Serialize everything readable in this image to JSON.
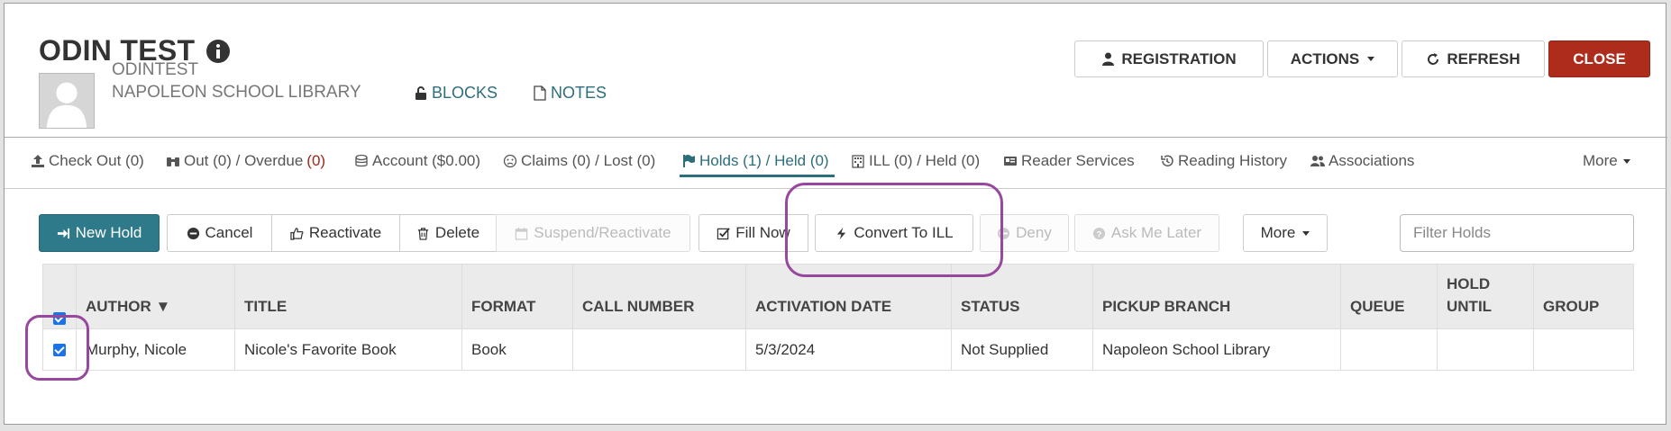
{
  "patron": {
    "name": "ODIN TEST",
    "username": "ODINTEST",
    "library": "NAPOLEON SCHOOL LIBRARY",
    "blocks_label": "BLOCKS",
    "notes_label": "NOTES"
  },
  "top_actions": {
    "registration": "REGISTRATION",
    "actions": "ACTIONS",
    "refresh": "REFRESH",
    "close": "CLOSE"
  },
  "tabs": [
    {
      "icon": "upload-icon",
      "label": "Check Out (0)"
    },
    {
      "icon": "binoculars-icon",
      "label_main": "Out (0) / Overdue ",
      "label_alert": "(0)"
    },
    {
      "icon": "money-icon",
      "label": "Account ($0.00)"
    },
    {
      "icon": "frown-icon",
      "label": "Claims (0) / Lost (0)"
    },
    {
      "icon": "flag-icon",
      "label": "Holds (1) / Held (0)",
      "active": true
    },
    {
      "icon": "building-icon",
      "label": "ILL (0) / Held (0)"
    },
    {
      "icon": "id-card-icon",
      "label": "Reader Services"
    },
    {
      "icon": "history-icon",
      "label": "Reading History"
    },
    {
      "icon": "users-icon",
      "label": "Associations"
    },
    {
      "label": "More"
    }
  ],
  "toolbar": {
    "new_hold": "New Hold",
    "cancel": "Cancel",
    "reactivate": "Reactivate",
    "delete": "Delete",
    "suspend": "Suspend/Reactivate",
    "fill_now": "Fill Now",
    "convert_ill": "Convert To ILL",
    "deny": "Deny",
    "ask_later": "Ask Me Later",
    "more": "More",
    "filter_placeholder": "Filter Holds"
  },
  "table": {
    "headers": [
      "AUTHOR ▼",
      "TITLE",
      "FORMAT",
      "CALL NUMBER",
      "ACTIVATION DATE",
      "STATUS",
      "PICKUP BRANCH",
      "QUEUE",
      "HOLD UNTIL",
      "GROUP"
    ],
    "rows": [
      [
        "Murphy, Nicole",
        "Nicole's Favorite Book",
        "Book",
        "",
        "5/3/2024",
        "Not Supplied",
        "Napoleon School Library",
        "",
        "",
        ""
      ]
    ]
  },
  "colors": {
    "accent": "#2c6e7c",
    "primary_button": "#2e7a8a",
    "danger": "#ad2c1c",
    "highlight": "#97479e",
    "overdue": "#a3261a"
  }
}
